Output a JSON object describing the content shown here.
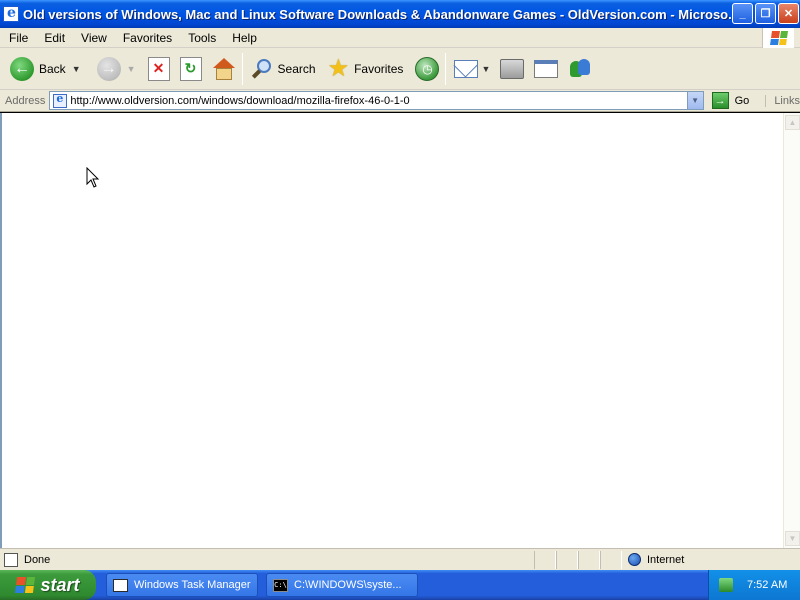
{
  "window": {
    "title": "Old versions of Windows, Mac and Linux Software Downloads & Abandonware Games - OldVersion.com - Microso...",
    "buttons": {
      "minimize": "_",
      "maximize": "❐",
      "close": "✕"
    }
  },
  "menubar": {
    "items": [
      "File",
      "Edit",
      "View",
      "Favorites",
      "Tools",
      "Help"
    ]
  },
  "toolbar": {
    "back_label": "Back",
    "search_label": "Search",
    "favorites_label": "Favorites"
  },
  "addressbar": {
    "label": "Address",
    "url": "http://www.oldversion.com/windows/download/mozilla-firefox-46-0-1-0",
    "go_label": "Go",
    "links_label": "Links"
  },
  "statusbar": {
    "status_text": "Done",
    "zone": "Internet"
  },
  "taskbar": {
    "start_label": "start",
    "tasks": [
      "Windows Task Manager",
      "C:\\WINDOWS\\syste..."
    ],
    "clock": "7:52 AM"
  },
  "colors": {
    "titlebar": "#0055e5",
    "chrome": "#ece9d8",
    "taskbar": "#245edb",
    "start_button": "#3c9a3c",
    "tray": "#0d77d2"
  }
}
